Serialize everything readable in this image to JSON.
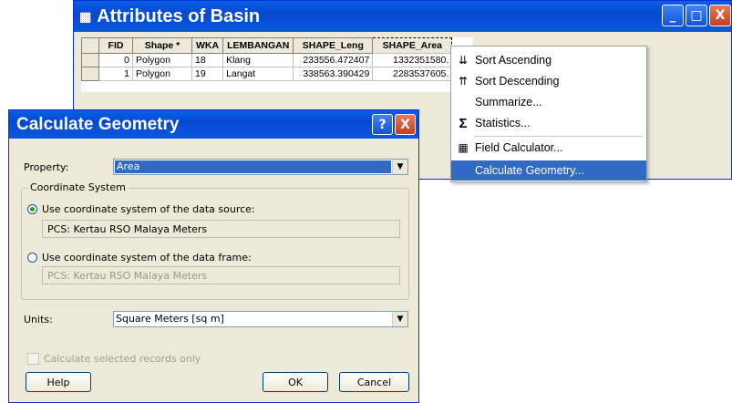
{
  "attributes_window": {
    "title": "Attributes of Basin",
    "columns": [
      "FID",
      "Shape *",
      "WKA",
      "LEMBANGAN",
      "SHAPE_Leng",
      "SHAPE_Area"
    ],
    "rows": [
      [
        "0",
        "Polygon",
        "18",
        "Klang",
        "233556.472407",
        "1332351580."
      ],
      [
        "1",
        "Polygon",
        "19",
        "Langat",
        "338563.390429",
        "2283537605."
      ]
    ],
    "buttons": {
      "minimize": "_",
      "maximize": "□",
      "close": "X"
    }
  },
  "context_menu": {
    "items": [
      {
        "label": "Sort Ascending",
        "icon": "sort-ascending-icon",
        "glyph": "⇊"
      },
      {
        "label": "Sort Descending",
        "icon": "sort-descending-icon",
        "glyph": "⇈"
      },
      {
        "label": "Summarize...",
        "icon": "",
        "glyph": ""
      },
      {
        "label": "Statistics...",
        "icon": "sigma-icon",
        "glyph": "Σ"
      },
      {
        "label": "Field Calculator...",
        "icon": "calculator-icon",
        "glyph": "▦"
      },
      {
        "label": "Calculate Geometry...",
        "icon": "",
        "glyph": ""
      }
    ]
  },
  "dialog": {
    "title": "Calculate Geometry",
    "help_glyph": "?",
    "close_glyph": "X",
    "property_label": "Property:",
    "property_value": "Area",
    "coord_group_label": "Coordinate System",
    "radio_source_label": "Use coordinate system of the data source:",
    "source_cs": "PCS: Kertau RSO Malaya Meters",
    "radio_frame_label": "Use coordinate system of the data frame:",
    "frame_cs": "PCS: Kertau RSO Malaya Meters",
    "units_label": "Units:",
    "units_value": "Square Meters [sq m]",
    "selected_only_label": "Calculate selected records only",
    "help_button": "Help",
    "ok_button": "OK",
    "cancel_button": "Cancel"
  },
  "colors": {
    "titlebar": "#0a5fe8",
    "highlight": "#316ac5",
    "dialog_bg": "#ece9d8"
  }
}
